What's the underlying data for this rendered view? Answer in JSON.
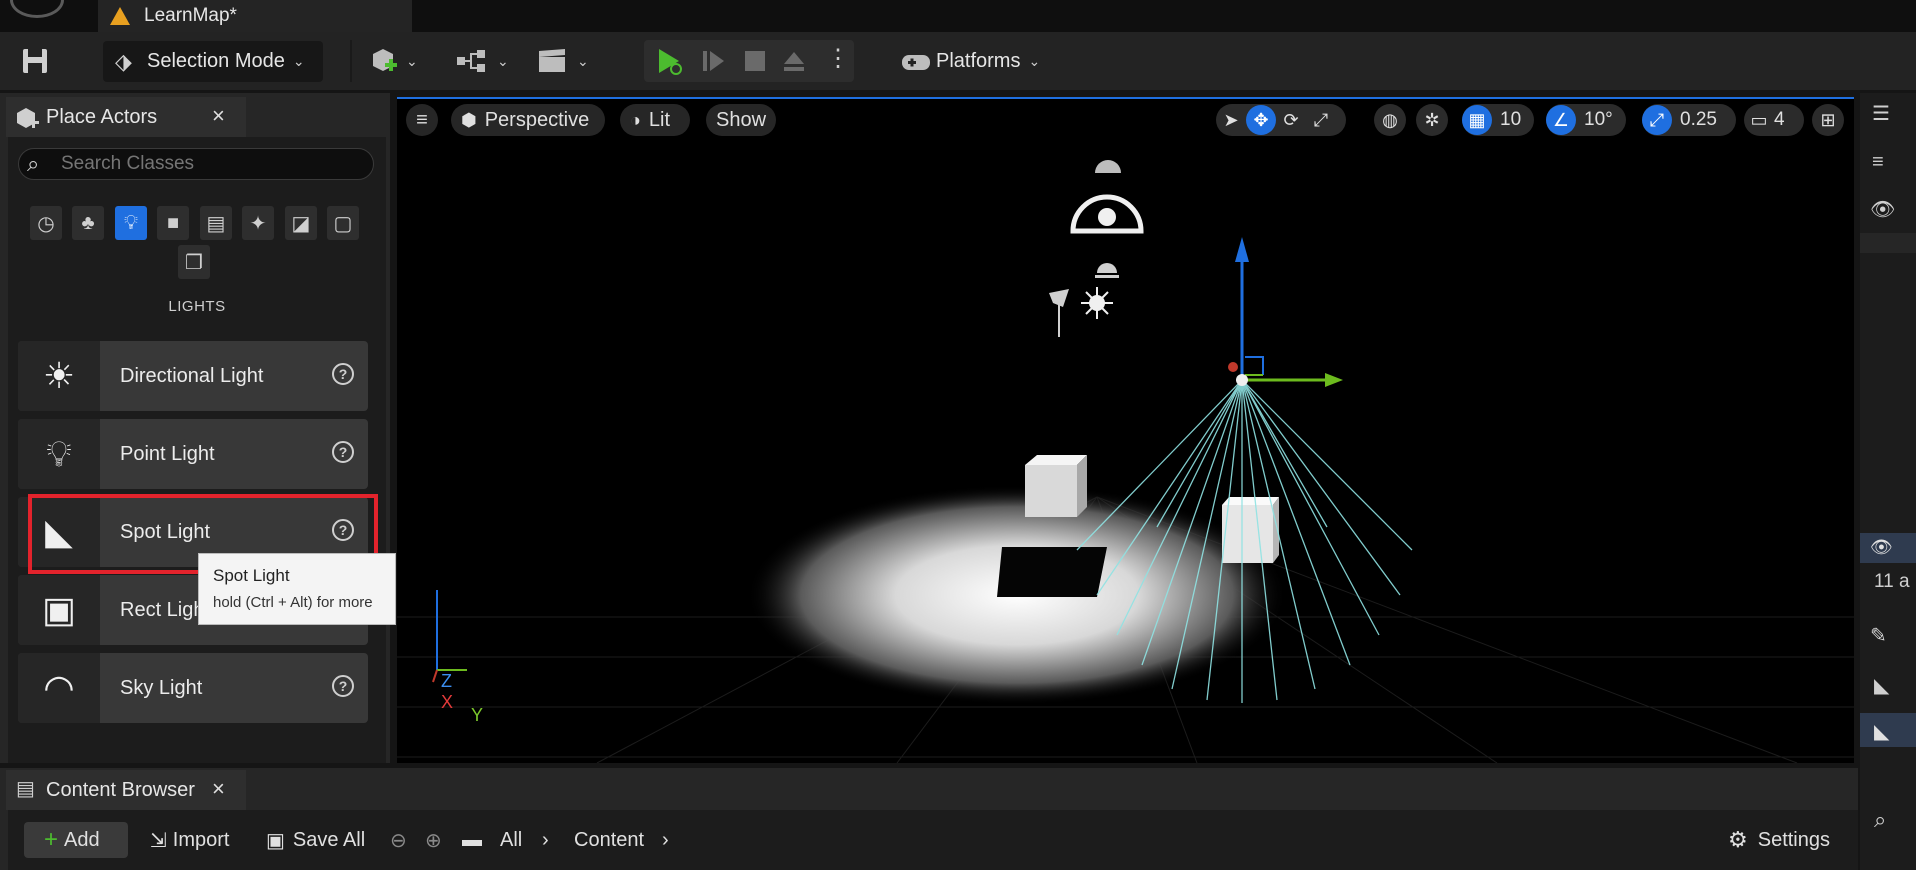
{
  "tab": {
    "title": "LearnMap*"
  },
  "toolbar": {
    "selection_mode": "Selection Mode",
    "platforms": "Platforms"
  },
  "place_actors": {
    "tab_label": "Place Actors",
    "search_placeholder": "Search Classes",
    "category_icons": [
      "recent-icon",
      "basic-icon",
      "lights-icon",
      "shapes-icon",
      "cinematic-icon",
      "visual-effects-icon",
      "geometry-icon",
      "volumes-icon",
      "all-classes-icon"
    ],
    "active_category": "lights-icon",
    "heading": "LIGHTS",
    "items": [
      {
        "label": "Directional Light",
        "icon": "directional-light-icon"
      },
      {
        "label": "Point Light",
        "icon": "point-light-icon"
      },
      {
        "label": "Spot Light",
        "icon": "spot-light-icon"
      },
      {
        "label": "Rect Light",
        "icon": "rect-light-icon"
      },
      {
        "label": "Sky Light",
        "icon": "sky-light-icon"
      }
    ],
    "tooltip": {
      "title": "Spot Light",
      "hint": "hold (Ctrl + Alt) for more"
    }
  },
  "viewport": {
    "perspective": "Perspective",
    "lit": "Lit",
    "show": "Show",
    "grid_snap": "10",
    "rotation_snap": "10°",
    "scale_snap": "0.25",
    "camera_speed": "4",
    "axis": {
      "z": "Z",
      "x": "X",
      "y": "Y"
    }
  },
  "right_panel": {
    "count_text": "11 a"
  },
  "content_browser": {
    "tab_label": "Content Browser",
    "add": "Add",
    "import": "Import",
    "save_all": "Save All",
    "breadcrumb": [
      "All",
      "Content"
    ],
    "settings": "Settings"
  },
  "colors": {
    "accent": "#1f6fe0",
    "highlight": "#e3232c",
    "play": "#4cbb2f"
  }
}
